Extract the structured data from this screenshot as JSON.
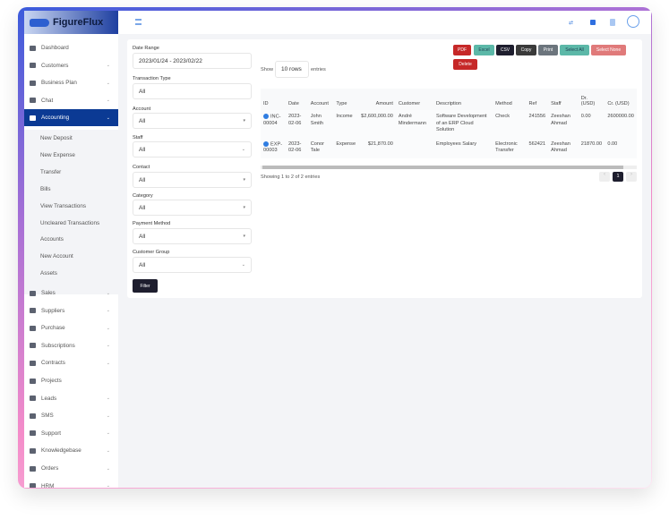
{
  "app": {
    "name": "FigureFlux"
  },
  "sidebar": {
    "items": [
      {
        "label": "Dashboard",
        "icon": "bar-chart-icon",
        "chevron": false
      },
      {
        "label": "Customers",
        "icon": "user-icon",
        "chevron": true
      },
      {
        "label": "Business Plan",
        "icon": "plan-icon",
        "chevron": true
      },
      {
        "label": "Chat",
        "icon": "chat-icon",
        "chevron": true
      },
      {
        "label": "Accounting",
        "icon": "calculator-icon",
        "chevron": true,
        "active": true
      }
    ],
    "sub_items": [
      "New Deposit",
      "New Expense",
      "Transfer",
      "Bills",
      "View Transactions",
      "Uncleared Transactions",
      "Accounts",
      "New Account",
      "Assets"
    ],
    "items_after": [
      {
        "label": "Sales",
        "icon": "wallet-icon"
      },
      {
        "label": "Suppliers",
        "icon": "suppliers-icon"
      },
      {
        "label": "Purchase",
        "icon": "purchase-icon"
      },
      {
        "label": "Subscriptions",
        "icon": "subscriptions-icon"
      },
      {
        "label": "Contracts",
        "icon": "clipboard-icon"
      },
      {
        "label": "Projects",
        "icon": "projects-icon"
      },
      {
        "label": "Leads",
        "icon": "leads-icon"
      },
      {
        "label": "SMS",
        "icon": "sms-icon"
      },
      {
        "label": "Support",
        "icon": "support-icon"
      },
      {
        "label": "Knowledgebase",
        "icon": "book-icon"
      },
      {
        "label": "Orders",
        "icon": "bag-icon"
      },
      {
        "label": "HRM",
        "icon": "hrm-icon"
      }
    ]
  },
  "filters": {
    "date_range": {
      "label": "Date Range",
      "value": "2023/01/24 - 2023/02/22"
    },
    "transaction_type": {
      "label": "Transaction Type",
      "value": "All"
    },
    "account": {
      "label": "Account",
      "value": "All"
    },
    "staff": {
      "label": "Staff",
      "value": "All"
    },
    "contact": {
      "label": "Contact",
      "value": "All"
    },
    "category": {
      "label": "Category",
      "value": "All"
    },
    "payment_method": {
      "label": "Payment Method",
      "value": "All"
    },
    "customer_group": {
      "label": "Customer Group",
      "value": "All"
    },
    "filter_button": "Filter"
  },
  "table_controls": {
    "show": "Show",
    "rows": "10 rows",
    "entries": "entries",
    "buttons": {
      "pdf": "PDF",
      "excel": "Excel",
      "csv": "CSV",
      "copy": "Copy",
      "print": "Print",
      "select_all": "Select All",
      "select_none": "Select None",
      "delete": "Delete"
    },
    "info": "Showing 1 to 2 of 2 entries",
    "page": "1"
  },
  "table": {
    "columns": [
      "ID",
      "Date",
      "Account",
      "Type",
      "Amount",
      "Customer",
      "Description",
      "Method",
      "Ref",
      "Staff",
      "Dr. (USD)",
      "Cr. (USD)"
    ],
    "rows": [
      [
        "INC-00004",
        "2023-02-06",
        "John Smith",
        "Income",
        "$2,600,000.00",
        "André Mindermann",
        "Software Development of an ERP Cloud Solution",
        "Check",
        "241556",
        "Zeeshan Ahmad",
        "0.00",
        "2600000.00"
      ],
      [
        "EXP-00003",
        "2023-02-06",
        "Conor Tale",
        "Expense",
        "$21,870.00",
        "",
        "Employees Salary",
        "Electronic Transfer",
        "562421",
        "Zeeshan Ahmad",
        "21870.00",
        "0.00"
      ]
    ]
  },
  "colors": {
    "accent": "#0b3a94",
    "pdf": "#c62828",
    "excel": "#5cb8a8",
    "csv": "#1e1e2e",
    "copy": "#3a3a3a",
    "print": "#6c757d",
    "select_none": "#e07a7a",
    "filter": "#1e1e2e"
  }
}
